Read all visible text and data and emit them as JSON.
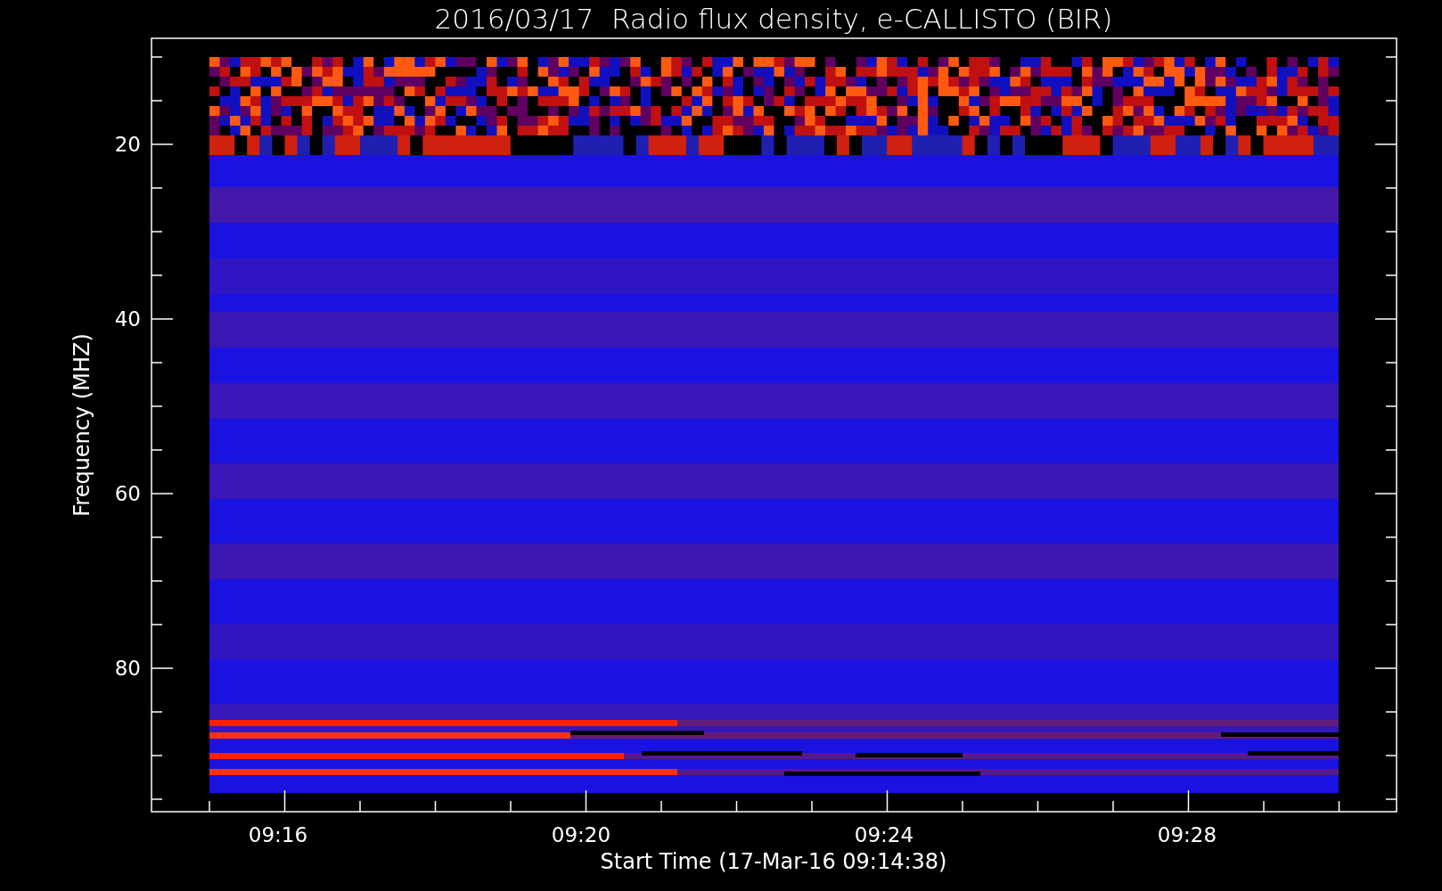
{
  "title": "2016/03/17  Radio flux density, e-CALLISTO (BIR)",
  "y_axis": {
    "label": "Frequency (MHZ)",
    "tick_labels": [
      "20",
      "40",
      "60",
      "80"
    ]
  },
  "x_axis": {
    "label": "Start Time (17-Mar-16 09:14:38)",
    "tick_labels": [
      "09:16",
      "09:20",
      "09:24",
      "09:28"
    ]
  }
}
